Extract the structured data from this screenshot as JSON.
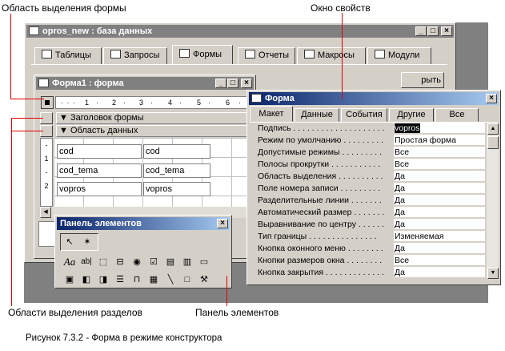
{
  "annotations": {
    "section_select": "Область выделения формы",
    "properties_window": "Окно свойств",
    "sections_select": "Области выделения разделов",
    "toolbox": "Панель элементов",
    "caption": "Рисунок 7.3.2 -  Форма в режиме конструктора"
  },
  "db_window": {
    "title": "opros_new : база данных",
    "tabs": [
      "Таблицы",
      "Запросы",
      "Формы",
      "Отчеты",
      "Макросы",
      "Модули"
    ],
    "button_partial": "рыть"
  },
  "form_window": {
    "title": "Форма1 : форма",
    "ruler_marks": [
      "1",
      "2",
      "3",
      "4",
      "5",
      "6"
    ],
    "section_header": "Заголовок формы",
    "section_data": "Область данных",
    "fields": [
      {
        "label": "cod",
        "value": "cod"
      },
      {
        "label": "cod_tema",
        "value": "cod_tema"
      },
      {
        "label": "vopros",
        "value": "vopros"
      }
    ],
    "vruler_marks": [
      "-",
      "1",
      "-",
      "2"
    ]
  },
  "properties": {
    "title": "Форма",
    "tabs": [
      "Макет",
      "Данные",
      "События",
      "Другие",
      "Все"
    ],
    "rows": [
      {
        "label": "Подпись . . . . . . . . . . . . . . . . . . . .",
        "value": "vopros"
      },
      {
        "label": "Режим по умолчанию . . . . . . . . .",
        "value": "Простая форма"
      },
      {
        "label": "Допустимые режимы . . . . . . . . .",
        "value": "Все"
      },
      {
        "label": "Полосы прокрутки . . . . . . . . . . .",
        "value": "Все"
      },
      {
        "label": "Область выделения . . . . . . . . . .",
        "value": "Да"
      },
      {
        "label": "Поле номера записи . . . . . . . . .",
        "value": "Да"
      },
      {
        "label": "Разделительные линии . . . . . . .",
        "value": "Да"
      },
      {
        "label": "Автоматический размер . . . . . . .",
        "value": "Да"
      },
      {
        "label": "Выравнивание по центру . . . . . .",
        "value": "Да"
      },
      {
        "label": "Тип границы . . . . . . . . . . . . . . .",
        "value": "Изменяемая"
      },
      {
        "label": "Кнопка оконного меню . . . . . . . .",
        "value": "Да"
      },
      {
        "label": "Кнопки размеров окна . . . . . . . .",
        "value": "Все"
      },
      {
        "label": "Кнопка закрытия . . . . . . . . . . . . .",
        "value": "Да"
      }
    ]
  },
  "toolbox": {
    "title": "Панель элементов",
    "label_tool": "Aa",
    "text_tool": "ab|"
  },
  "colors": {
    "annotation_line": "#e00000",
    "active_title": "#0a246a",
    "inactive_title": "#808080"
  }
}
